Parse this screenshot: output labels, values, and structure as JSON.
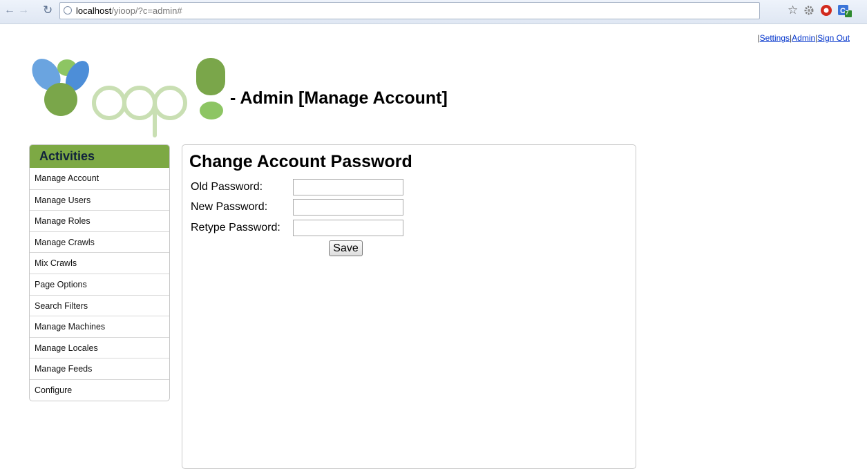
{
  "browser": {
    "url_host": "localhost",
    "url_path": "/yioop/?c=admin#"
  },
  "toplinks": {
    "sep": "|",
    "settings": "Settings",
    "admin": "Admin",
    "signout": "Sign Out"
  },
  "header": {
    "title": "- Admin [Manage Account]"
  },
  "sidebar": {
    "title": "Activities",
    "items": [
      {
        "label": "Manage Account"
      },
      {
        "label": "Manage Users"
      },
      {
        "label": "Manage Roles"
      },
      {
        "label": "Manage Crawls"
      },
      {
        "label": "Mix Crawls"
      },
      {
        "label": "Page Options"
      },
      {
        "label": "Search Filters"
      },
      {
        "label": "Manage Machines"
      },
      {
        "label": "Manage Locales"
      },
      {
        "label": "Manage Feeds"
      },
      {
        "label": "Configure"
      }
    ]
  },
  "main": {
    "title": "Change Account Password",
    "old_password_label": "Old Password:",
    "new_password_label": "New Password:",
    "retype_password_label": "Retype Password:",
    "save_label": "Save"
  },
  "extensions": {
    "badge_count": "7"
  }
}
